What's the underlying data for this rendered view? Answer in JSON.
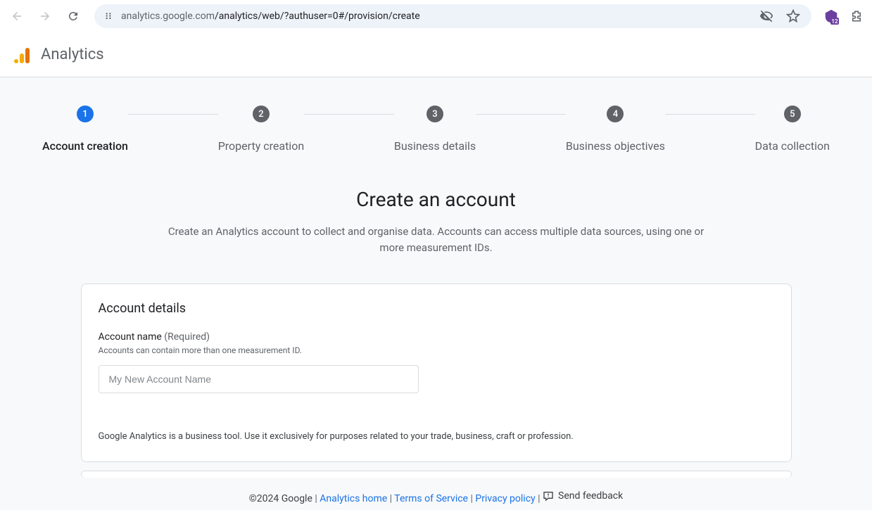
{
  "browser": {
    "url_host": "analytics.google.com",
    "url_path": "/analytics/web/?authuser=0#/provision/create",
    "ext_badge": "12"
  },
  "header": {
    "app_name": "Analytics"
  },
  "stepper": {
    "steps": [
      {
        "num": "1",
        "label": "Account creation"
      },
      {
        "num": "2",
        "label": "Property creation"
      },
      {
        "num": "3",
        "label": "Business details"
      },
      {
        "num": "4",
        "label": "Business objectives"
      },
      {
        "num": "5",
        "label": "Data collection"
      }
    ]
  },
  "page": {
    "title": "Create an account",
    "subtitle": "Create an Analytics account to collect and organise data. Accounts can access multiple data sources, using one or more measurement IDs."
  },
  "card": {
    "title": "Account details",
    "field_label": "Account name",
    "field_required": " (Required)",
    "field_hint": "Accounts can contain more than one measurement ID.",
    "placeholder": "My New Account Name",
    "disclaimer": "Google Analytics is a business tool. Use it exclusively for purposes related to your trade, business, craft or profession."
  },
  "footer": {
    "copyright": "©2024 Google",
    "links": {
      "home": "Analytics home",
      "tos": "Terms of Service",
      "privacy": "Privacy policy"
    },
    "feedback": "Send feedback"
  }
}
